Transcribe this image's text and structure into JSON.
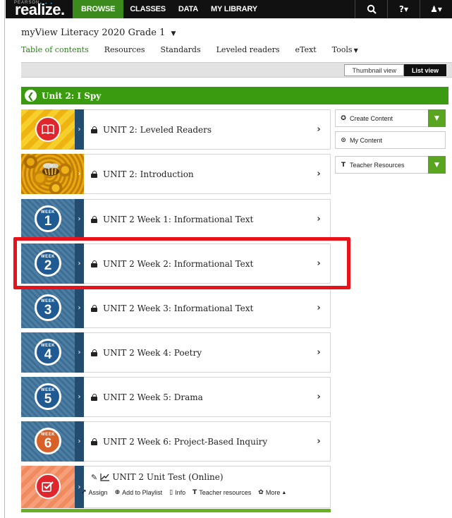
{
  "brand": {
    "company": "PEARSON",
    "product": "realize.",
    "dots": "• • •"
  },
  "nav": {
    "items": [
      {
        "label": "BROWSE",
        "active": true
      },
      {
        "label": "CLASSES",
        "active": false
      },
      {
        "label": "DATA",
        "active": false
      },
      {
        "label": "MY LIBRARY",
        "active": false
      }
    ],
    "icons": [
      {
        "name": "search-icon",
        "glyph": "⚲"
      },
      {
        "name": "help-icon",
        "glyph": "?▾"
      },
      {
        "name": "user-icon",
        "glyph": "♟▾"
      }
    ]
  },
  "program": {
    "title": "myView Literacy 2020 Grade 1",
    "caret": "▼"
  },
  "tabs": [
    {
      "label": "Table of contents",
      "active": true
    },
    {
      "label": "Resources"
    },
    {
      "label": "Standards"
    },
    {
      "label": "Leveled readers"
    },
    {
      "label": "eText"
    },
    {
      "label": "Tools",
      "caret": "▼"
    }
  ],
  "view_toggle": {
    "thumbnail": "Thumbnail view",
    "list": "List view",
    "selected": "List view"
  },
  "unit": {
    "title": "Unit 2: I Spy",
    "back_glyph": "❮"
  },
  "items": [
    {
      "label": "UNIT 2: Leveled Readers",
      "thumb": "book-icon",
      "locked": true
    },
    {
      "label": "UNIT 2: Introduction",
      "thumb": "bee-photo",
      "locked": true
    },
    {
      "label": "UNIT 2 Week 1: Informational Text",
      "week": "1",
      "locked": true
    },
    {
      "label": "UNIT 2 Week 2: Informational Text",
      "week": "2",
      "locked": true,
      "highlighted": true
    },
    {
      "label": "UNIT 2 Week 3: Informational Text",
      "week": "3",
      "locked": true
    },
    {
      "label": "UNIT 2 Week 4: Poetry",
      "week": "4",
      "locked": true
    },
    {
      "label": "UNIT 2 Week 5: Drama",
      "week": "5",
      "locked": true
    },
    {
      "label": "UNIT 2 Week 6: Project-Based Inquiry",
      "week": "6",
      "locked": true
    },
    {
      "label": "UNIT 2 Unit Test (Online)",
      "thumb": "test-check-icon",
      "locked": false
    }
  ],
  "week_label": "WEEK",
  "thumb_arrow": "›",
  "chevron": "›",
  "test_actions": [
    {
      "label": "Assign",
      "icon": "assign-icon",
      "glyph": "↗"
    },
    {
      "label": "Add to Playlist",
      "icon": "add-playlist-icon",
      "glyph": "⊕"
    },
    {
      "label": "Info",
      "icon": "info-icon",
      "glyph": "▯"
    },
    {
      "label": "Teacher resources",
      "icon": "teacher-resources-icon",
      "glyph": "T"
    },
    {
      "label": "More",
      "icon": "more-icon",
      "glyph": "✿",
      "caret": "▲"
    }
  ],
  "test_icons": {
    "tool": "✎",
    "chart": "⟋"
  },
  "side_panel": [
    {
      "label": "Create Content",
      "icon_glyph": "✪",
      "dropdown": true
    },
    {
      "label": "My Content",
      "icon_glyph": "⊙",
      "dropdown": false
    },
    {
      "label": "Teacher Resources",
      "icon_glyph": "T",
      "dropdown": true
    }
  ],
  "dropdown_glyph": "▼",
  "colors": {
    "brand_green": "#3a9a10",
    "accent_green": "#6ab023",
    "highlight_red": "#e8121b",
    "week_blue": "#1f5a93",
    "week6_orange": "#d8612a",
    "topbar": "#111111"
  }
}
